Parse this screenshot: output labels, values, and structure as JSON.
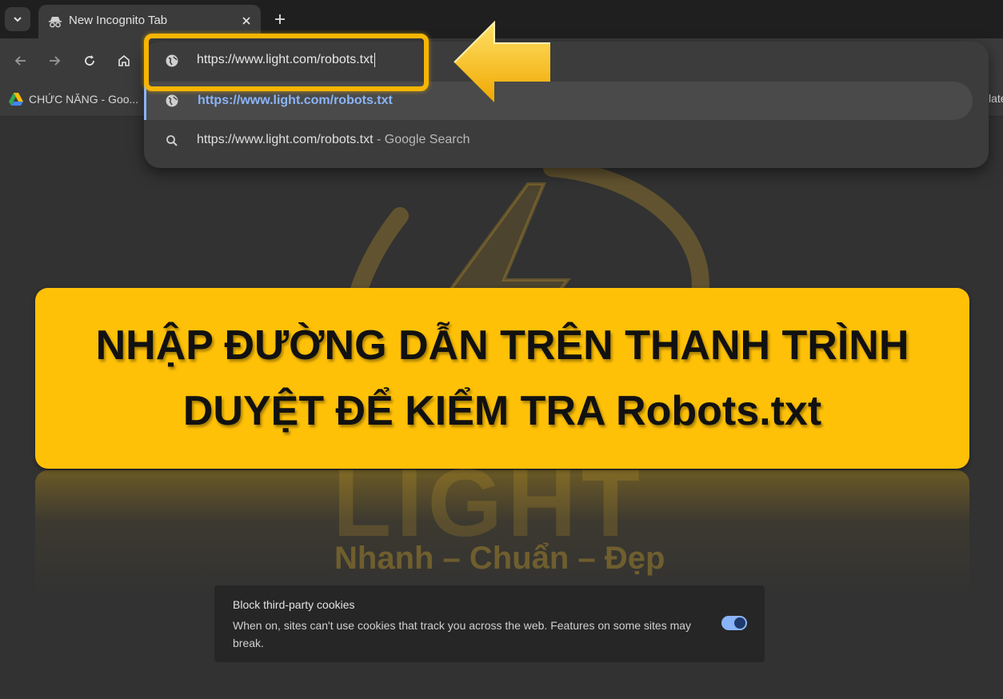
{
  "browser": {
    "tab": {
      "title": "New Incognito Tab"
    },
    "omnibox": {
      "value": "https://www.light.com/robots.txt",
      "suggestions": [
        {
          "text": "https://www.light.com/robots.txt"
        },
        {
          "text": "https://www.light.com/robots.txt",
          "sub": " - Google Search"
        }
      ]
    },
    "bookmarks": {
      "first": "CHỨC NĂNG - Goo...",
      "right_fragment": "late"
    }
  },
  "banner": {
    "line1": "NHẬP ĐƯỜNG DẪN TRÊN THANH TRÌNH",
    "line2": "DUYỆT ĐỂ KIỂM TRA Robots.txt"
  },
  "watermark": {
    "logo": "LIGHT",
    "tagline": "Nhanh – Chuẩn – Đẹp"
  },
  "cookie_card": {
    "title": "Block third-party cookies",
    "description": "When on, sites can't use cookies that track you across the web. Features on some sites may break.",
    "toggle_on": true
  },
  "colors": {
    "accent_yellow": "#ffc107",
    "link_blue": "#8ab4f8"
  }
}
